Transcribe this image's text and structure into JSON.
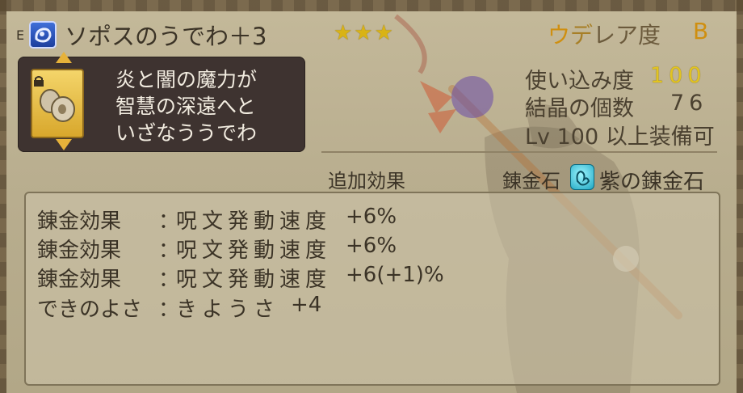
{
  "item": {
    "equipped_marker": "E",
    "icon": "bracelet-icon",
    "name": "ソポスのうでわ＋3",
    "stars": "★★★",
    "rarity_label_u": "ウ",
    "rarity_label_de": "デ",
    "rarity_label_rest": "レア度",
    "rarity_value": "B"
  },
  "description": {
    "icon": "bracelet-item-icon",
    "text": "炎と闇の魔力が\n智慧の深遠へと\nいざなううでわ"
  },
  "stats": {
    "usage_label": "使い込み度",
    "usage_value": "100",
    "crystals_label": "結晶の個数",
    "crystals_value": "76",
    "level_label": "Lv 100 以上装備可"
  },
  "effects": {
    "header": "追加効果",
    "stone_label": "錬金石",
    "stone_icon": "purple-alchemy-stone-icon",
    "stone_value": "紫の錬金石",
    "lines": [
      {
        "label": "錬金効果",
        "sep": "：",
        "value": "呪文発動速度",
        "amount": "+6%"
      },
      {
        "label": "錬金効果",
        "sep": "：",
        "value": "呪文発動速度",
        "amount": "+6%"
      },
      {
        "label": "錬金効果",
        "sep": "：",
        "value": "呪文発動速度",
        "amount": "+6(+1)%"
      },
      {
        "label": "できのよさ",
        "sep": "：",
        "value": "きようさ",
        "amount": "+4"
      }
    ]
  },
  "colors": {
    "panel_bg": "#b9ae8f",
    "desc_bg": "#3e3330",
    "gold": "#e2c420",
    "rarity_orange": "#cf8f10",
    "icon_blue": "#2f5fd0"
  }
}
